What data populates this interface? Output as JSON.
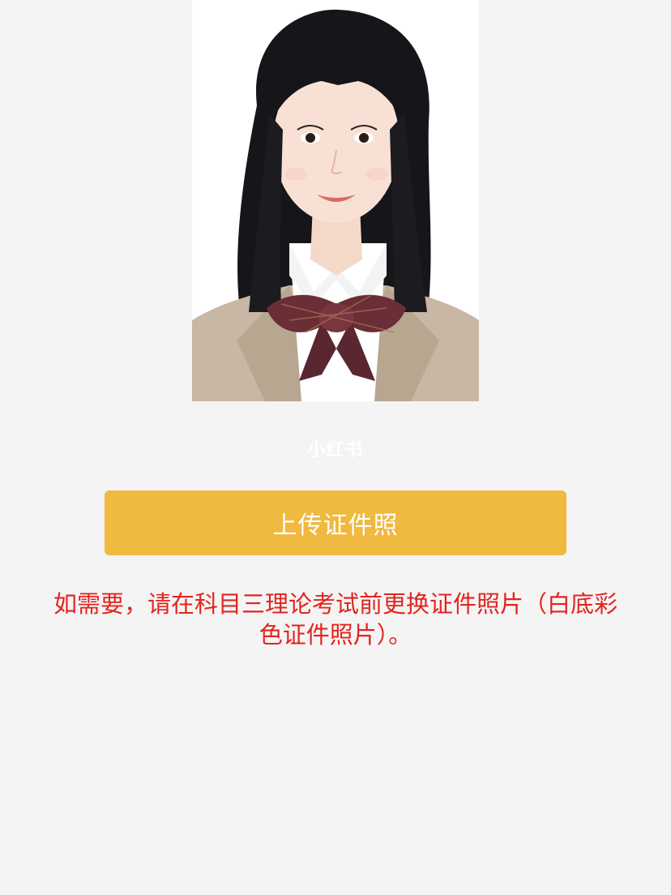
{
  "photo": {
    "kind": "portrait-photo",
    "background_color": "#ffffff"
  },
  "watermark": {
    "text": "小红书"
  },
  "upload": {
    "label": "上传证件照",
    "color": "#f0b93f"
  },
  "notice": {
    "text": "如需要，请在科目三理论考试前更换证件照片（白底彩色证件照片）。",
    "color": "#e3241e"
  }
}
